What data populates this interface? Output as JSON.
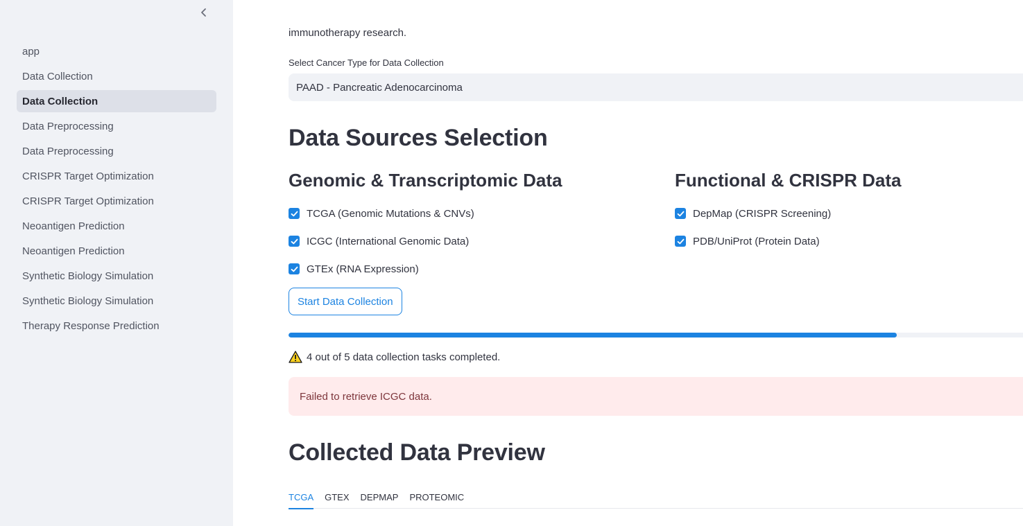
{
  "sidebar": {
    "items": [
      {
        "label": "app",
        "active": false
      },
      {
        "label": "Data Collection",
        "active": false
      },
      {
        "label": "Data Collection",
        "active": true
      },
      {
        "label": "Data Preprocessing",
        "active": false
      },
      {
        "label": "Data Preprocessing",
        "active": false
      },
      {
        "label": "CRISPR Target Optimization",
        "active": false
      },
      {
        "label": "CRISPR Target Optimization",
        "active": false
      },
      {
        "label": "Neoantigen Prediction",
        "active": false
      },
      {
        "label": "Neoantigen Prediction",
        "active": false
      },
      {
        "label": "Synthetic Biology Simulation",
        "active": false
      },
      {
        "label": "Synthetic Biology Simulation",
        "active": false
      },
      {
        "label": "Therapy Response Prediction",
        "active": false
      }
    ]
  },
  "main": {
    "intro_text": "immunotherapy research.",
    "cancer_select": {
      "label": "Select Cancer Type for Data Collection",
      "value": "PAAD - Pancreatic Adenocarcinoma"
    },
    "sources_heading": "Data Sources Selection",
    "genomic": {
      "heading": "Genomic & Transcriptomic Data",
      "options": [
        {
          "label": "TCGA (Genomic Mutations & CNVs)",
          "checked": true
        },
        {
          "label": "ICGC (International Genomic Data)",
          "checked": true
        },
        {
          "label": "GTEx (RNA Expression)",
          "checked": true
        }
      ]
    },
    "functional": {
      "heading": "Functional & CRISPR Data",
      "options": [
        {
          "label": "DepMap (CRISPR Screening)",
          "checked": true
        },
        {
          "label": "PDB/UniProt (Protein Data)",
          "checked": true
        }
      ]
    },
    "start_button": "Start Data Collection",
    "progress": {
      "completed": 4,
      "total": 5,
      "fraction": 0.82
    },
    "status_text": "4 out of 5 data collection tasks completed.",
    "error_text": "Failed to retrieve ICGC data.",
    "preview_heading": "Collected Data Preview",
    "tabs": [
      {
        "label": "TCGA",
        "active": true
      },
      {
        "label": "GTEX",
        "active": false
      },
      {
        "label": "DEPMAP",
        "active": false
      },
      {
        "label": "PROTEOMIC",
        "active": false
      }
    ]
  },
  "colors": {
    "accent": "#1c83e1",
    "sidebar_bg": "#f0f2f6",
    "error_bg": "#ffebec",
    "error_text": "#7d353b"
  },
  "icons": {
    "collapse": "chevron-left-icon",
    "checkbox": "check-icon",
    "warning": "warning-icon"
  }
}
